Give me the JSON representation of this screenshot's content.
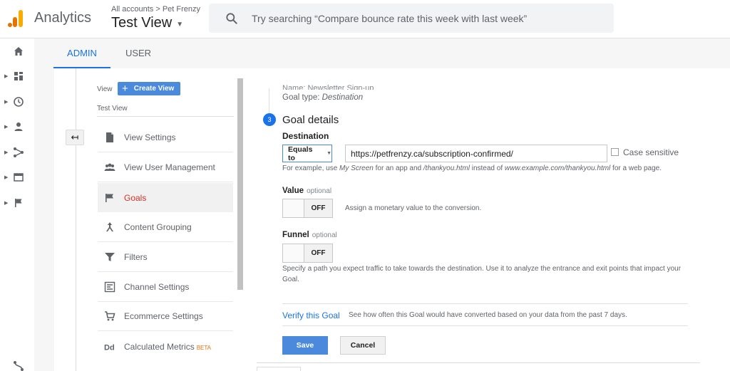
{
  "app": {
    "brand": "Analytics",
    "breadcrumb": "All accounts > Pet Frenzy",
    "view_title": "Test View"
  },
  "search": {
    "placeholder": "Try searching “Compare bounce rate this week with last week”"
  },
  "rail": {
    "items": [
      "home-icon",
      "dashboard-icon",
      "clock-icon",
      "person-icon",
      "acquisition-icon",
      "behavior-icon",
      "flag-icon",
      "discover-icon"
    ]
  },
  "tabs": [
    {
      "label": "ADMIN",
      "active": true
    },
    {
      "label": "USER",
      "active": false
    }
  ],
  "view_panel": {
    "view_label": "View",
    "create_label": "Create View",
    "view_name": "Test View",
    "back_glyph": "↤",
    "items": [
      {
        "label": "View Settings",
        "icon": "document-icon"
      },
      {
        "label": "View User Management",
        "icon": "users-icon"
      },
      {
        "label": "Goals",
        "icon": "flag-icon",
        "selected": true
      },
      {
        "label": "Content Grouping",
        "icon": "content-grouping-icon"
      },
      {
        "label": "Filters",
        "icon": "filter-icon"
      },
      {
        "label": "Channel Settings",
        "icon": "channel-icon"
      },
      {
        "label": "Ecommerce Settings",
        "icon": "cart-icon"
      },
      {
        "label": "Calculated Metrics",
        "icon": "dd-icon",
        "badge": "BETA"
      }
    ]
  },
  "goal": {
    "clipped_text": "Name: Newsletter Sign-up",
    "goal_type_label": "Goal type:",
    "goal_type_value": "Destination",
    "step_number": "3",
    "section_title": "Goal details",
    "destination_label": "Destination",
    "match_type": "Equals to",
    "destination_url": "https://petfrenzy.ca/subscription-confirmed/",
    "case_sensitive_label": "Case sensitive",
    "hint": {
      "p1": "For example, use ",
      "i1": "My Screen",
      "p2": " for an app and ",
      "i2": "/thankyou.html",
      "p3": " instead of ",
      "i3": "www.example.com/thankyou.html",
      "p4": " for a web page."
    },
    "value_label": "Value",
    "optional": "optional",
    "value_state": "OFF",
    "value_desc": "Assign a monetary value to the conversion.",
    "funnel_label": "Funnel",
    "funnel_state": "OFF",
    "funnel_desc": "Specify a path you expect traffic to take towards the destination. Use it to analyze the entrance and exit points that impact your Goal.",
    "verify_label": "Verify this Goal",
    "verify_desc": "See how often this Goal would have converted based on your data from the past 7 days.",
    "save_label": "Save",
    "cancel_label": "Cancel"
  },
  "colors": {
    "accent": "#1a73e8",
    "button_blue": "#4a89dc",
    "selected_text": "#d93025",
    "beta": "#e8710a"
  }
}
